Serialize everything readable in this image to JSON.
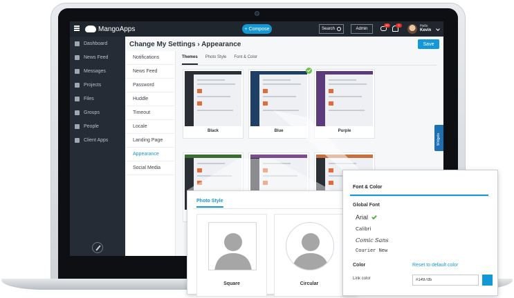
{
  "app": {
    "logo_text": "MangoApps"
  },
  "topbar": {
    "compose_label": "+ Compose",
    "search_label": "Search",
    "admin_label": "Admin",
    "chat_badge": "42",
    "alert_badge": "2",
    "hello_text": "Hello",
    "user_name": "Kevin"
  },
  "sidebar": {
    "items": [
      {
        "label": "Dashboard",
        "icon": "home-icon"
      },
      {
        "label": "News Feed",
        "icon": "feed-icon"
      },
      {
        "label": "Messages",
        "icon": "envelope-icon"
      },
      {
        "label": "Projects",
        "icon": "briefcase-icon"
      },
      {
        "label": "Files",
        "icon": "file-icon"
      },
      {
        "label": "Groups",
        "icon": "groups-icon"
      },
      {
        "label": "People",
        "icon": "person-icon"
      },
      {
        "label": "Client Apps",
        "icon": "download-icon"
      }
    ]
  },
  "page": {
    "title": "Change My Settings › Appearance",
    "save_label": "Save"
  },
  "settings_menu": {
    "items": [
      "Notifications",
      "News Feed",
      "Password",
      "Huddle",
      "Timeout",
      "Locale",
      "Landing Page",
      "Appearance",
      "Social Media"
    ],
    "active": "Appearance"
  },
  "tabs": [
    "Themes",
    "Photo Style",
    "Font & Color"
  ],
  "themes": [
    {
      "label": "Black",
      "bar_color": "#2a2f36",
      "selected": false
    },
    {
      "label": "Blue",
      "bar_color": "#1f3f66",
      "selected": true
    },
    {
      "label": "Purple",
      "bar_color": "#5b3b7c",
      "selected": false
    }
  ],
  "widgets_label": "Widgets",
  "photo_style": {
    "tab_label": "Photo Style",
    "options": [
      {
        "label": "Square"
      },
      {
        "label": "Circular"
      }
    ]
  },
  "font_color": {
    "tab_label": "Font & Color",
    "global_font_title": "Global Font",
    "fonts": [
      {
        "label": "Arial",
        "selected": true
      },
      {
        "label": "Calibri",
        "selected": false
      },
      {
        "label": "Comic Sans",
        "selected": false
      },
      {
        "label": "Courier New",
        "selected": false
      }
    ],
    "color_title": "Color",
    "reset_label": "Reset to default color",
    "link_color_label": "Link color",
    "link_color_value": "#1497d5"
  },
  "colors": {
    "accent": "#1497d5",
    "nav_bg": "#20262e",
    "sidebar_bg": "#262c35"
  }
}
